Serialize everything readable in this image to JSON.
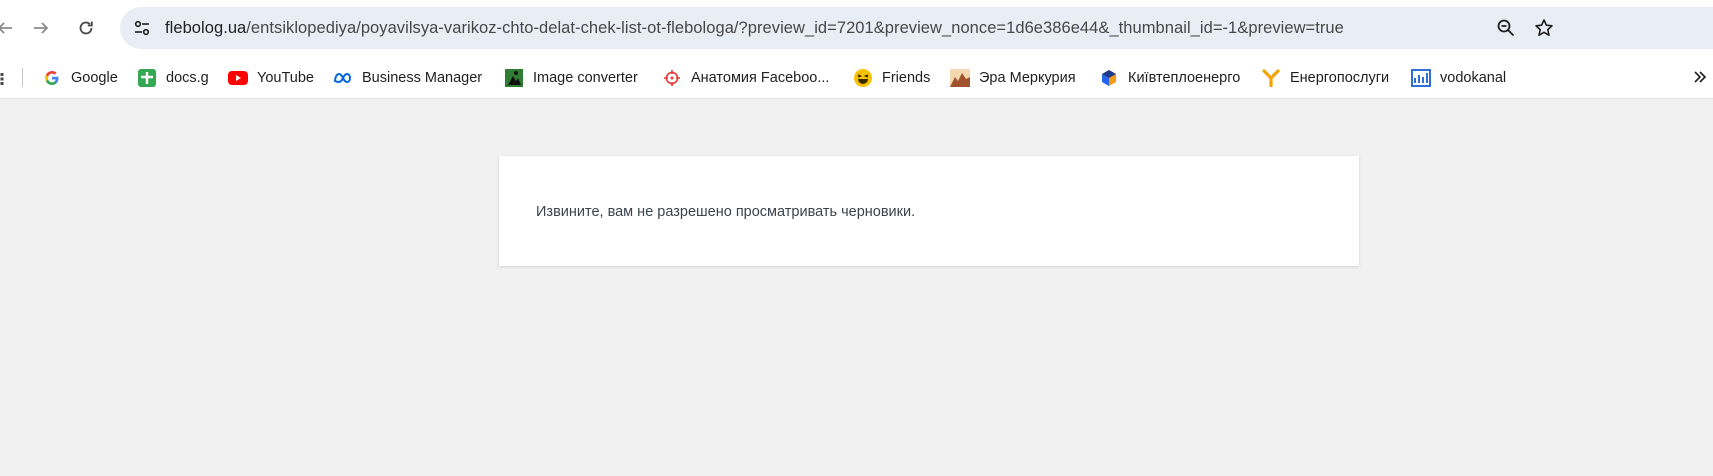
{
  "browser": {
    "url_host": "flebolog.ua",
    "url_path": "/entsiklopediya/poyavilsya-varikoz-chto-delat-chek-list-ot-flebologa/?preview_id=7201&preview_nonce=1d6e386e44&_thumbnail_id=-1&preview=true",
    "icons": {
      "back": "arrow-left-icon",
      "forward": "arrow-right-icon",
      "reload": "reload-icon",
      "site_info": "tune-icon",
      "zoom": "zoom-out-icon",
      "bookmark": "star-icon"
    }
  },
  "bookmarks": [
    {
      "label": "Google",
      "icon": "google-icon"
    },
    {
      "label": "docs.g",
      "icon": "docs-plus-icon"
    },
    {
      "label": "YouTube",
      "icon": "youtube-icon"
    },
    {
      "label": "Business Manager",
      "icon": "meta-icon"
    },
    {
      "label": "Image converter",
      "icon": "image-converter-icon"
    },
    {
      "label": "Анатомия Faceboo...",
      "icon": "crosshair-icon"
    },
    {
      "label": "Friends",
      "icon": "laughing-emoji-icon"
    },
    {
      "label": "Эра Меркурия",
      "icon": "landscape-icon"
    },
    {
      "label": "Київтеплоенерго",
      "icon": "cube-icon"
    },
    {
      "label": "Енергопослуги",
      "icon": "y-logo-icon"
    },
    {
      "label": "vodokanal",
      "icon": "chart-window-icon"
    }
  ],
  "page": {
    "message": "Извините, вам не разрешено просматривать черновики."
  },
  "colors": {
    "omnibox_bg": "#e9eef6",
    "page_bg": "#f1f1f1",
    "card_bg": "#ffffff",
    "message_text": "#3c434a"
  }
}
